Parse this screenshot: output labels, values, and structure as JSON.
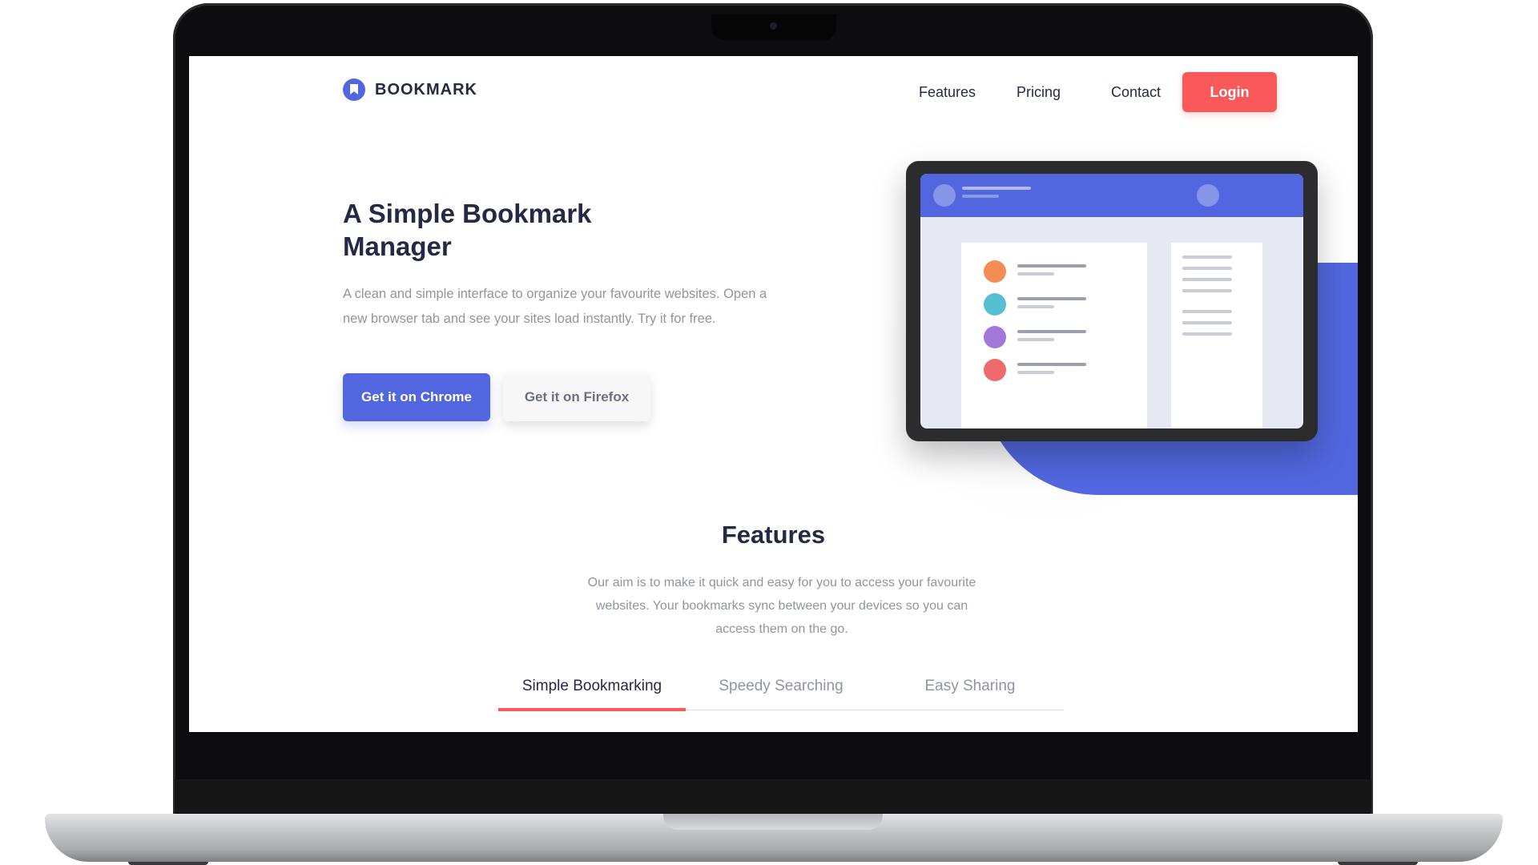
{
  "header": {
    "logo_text": "BOOKMARK",
    "nav": [
      "Features",
      "Pricing",
      "Contact"
    ],
    "login_label": "Login"
  },
  "hero": {
    "title": "A Simple Bookmark Manager",
    "description": "A clean and simple interface to organize your favourite websites. Open a new browser tab and see your sites load instantly. Try it for free.",
    "chrome_button": "Get it on Chrome",
    "firefox_button": "Get it on Firefox"
  },
  "features": {
    "title": "Features",
    "description": "Our aim is to make it quick and easy for you to access your favourite websites. Your bookmarks sync between your devices so you can access them on the go.",
    "tabs": [
      "Simple Bookmarking",
      "Speedy Searching",
      "Easy Sharing"
    ],
    "active_tab": "Simple Bookmarking"
  },
  "colors": {
    "primary": "#5267df",
    "accent": "#fa5959",
    "text_dark": "#242a45",
    "text_muted": "#9194a1",
    "dot_colors": [
      "#f48c56",
      "#56bfd1",
      "#a178d9",
      "#ef6a6a"
    ]
  },
  "icons": {
    "logo": "bookmark-icon"
  }
}
